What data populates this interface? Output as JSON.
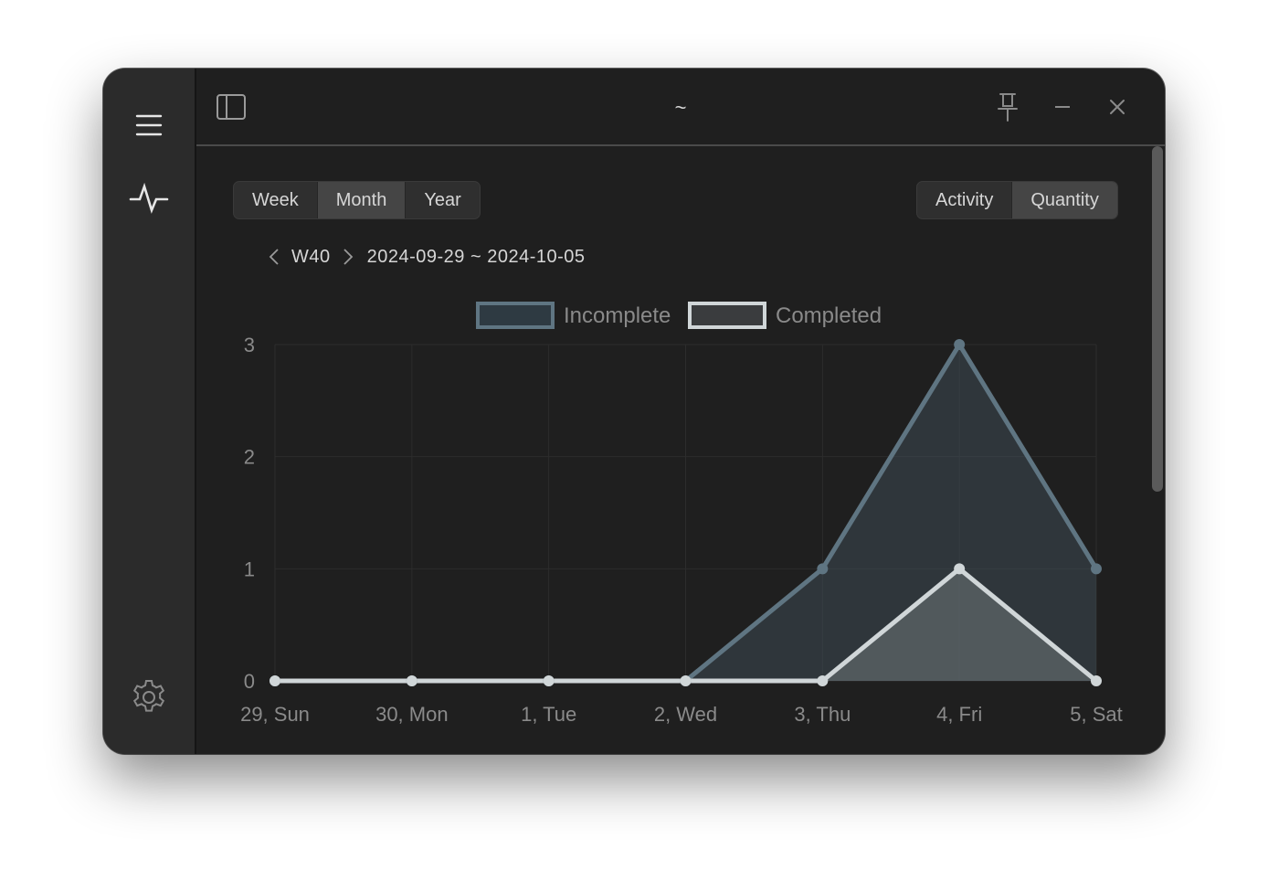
{
  "window": {
    "title": "~",
    "sidebar": {
      "menu_icon": "hamburger-menu-icon",
      "activity_icon": "activity-pulse-icon",
      "settings_icon": "gear-icon"
    },
    "titlebar_icons": [
      "sidebar-toggle-icon",
      "pin-icon",
      "minimize-icon",
      "close-icon"
    ]
  },
  "range_tabs": {
    "items": [
      "Week",
      "Month",
      "Year"
    ],
    "selected": "Month"
  },
  "mode_tabs": {
    "items": [
      "Activity",
      "Quantity"
    ],
    "selected": "Quantity"
  },
  "period": {
    "week": "W40",
    "range": "2024-09-29 ~ 2024-10-05"
  },
  "colors": {
    "incomplete": "#5f7582",
    "completed": "#d0d6d8",
    "background": "#1f1f1f"
  },
  "chart_data": {
    "type": "area",
    "categories": [
      "29, Sun",
      "30, Mon",
      "1, Tue",
      "2, Wed",
      "3, Thu",
      "4, Fri",
      "5, Sat"
    ],
    "series": [
      {
        "name": "Incomplete",
        "values": [
          0,
          0,
          0,
          0,
          1,
          3,
          1
        ]
      },
      {
        "name": "Completed",
        "values": [
          0,
          0,
          0,
          0,
          0,
          1,
          0
        ]
      }
    ],
    "ylim": [
      0,
      3
    ],
    "yticks": [
      "0",
      "1",
      "2",
      "3"
    ],
    "grid": true,
    "legend": "top-center"
  }
}
